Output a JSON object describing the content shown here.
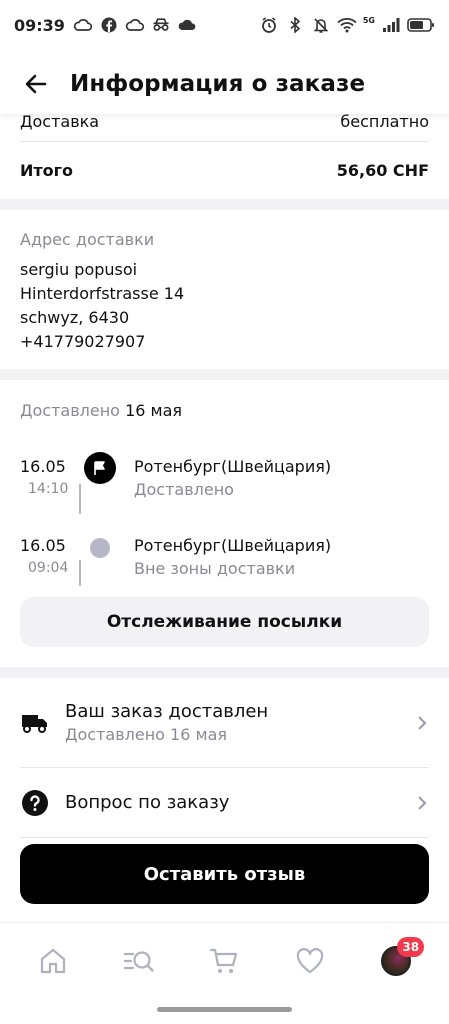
{
  "status_bar": {
    "time": "09:39",
    "network_label": "5G",
    "icons_left": [
      "cloud-icon",
      "facebook-icon",
      "cloud-icon",
      "incognito-icon",
      "cloud-filled-icon"
    ],
    "icons_right": [
      "alarm-icon",
      "bluetooth-icon",
      "mute-icon",
      "wifi-icon",
      "signal-icon",
      "battery-icon"
    ]
  },
  "header": {
    "title": "Информация о заказе"
  },
  "summary": {
    "partial_label": "Доставка",
    "partial_value": "бесплатно",
    "total_label": "Итого",
    "total_value": "56,60 CHF"
  },
  "address": {
    "label": "Адрес доставки",
    "lines": [
      "sergiu popusoi",
      "Hinterdorfstrasse 14",
      "schwyz, 6430",
      "+41779027907"
    ]
  },
  "tracking": {
    "delivered_label": "Доставлено",
    "delivered_date": "16 мая",
    "events": [
      {
        "date": "16.05",
        "time": "14:10",
        "place": "Ротенбург(Швейцария)",
        "status": "Доставлено"
      },
      {
        "date": "16.05",
        "time": "09:04",
        "place": "Ротенбург(Швейцария)",
        "status": "Вне зоны доставки"
      }
    ],
    "track_button": "Отслеживание посылки"
  },
  "actions": {
    "delivered_title": "Ваш заказ доставлен",
    "delivered_sub": "Доставлено 16 мая",
    "question_title": "Вопрос по заказу",
    "review_button": "Оставить отзыв"
  },
  "bottom_nav": {
    "items": [
      "home-icon",
      "catalog-search-icon",
      "cart-icon",
      "favorites-icon",
      "profile-avatar"
    ],
    "profile_badge": "38"
  },
  "colors": {
    "accent": "#000000",
    "muted_text": "#8a8a96",
    "divider": "#f2f2f5",
    "badge": "#f23a4c",
    "timeline_grey": "#b5b6c6"
  }
}
